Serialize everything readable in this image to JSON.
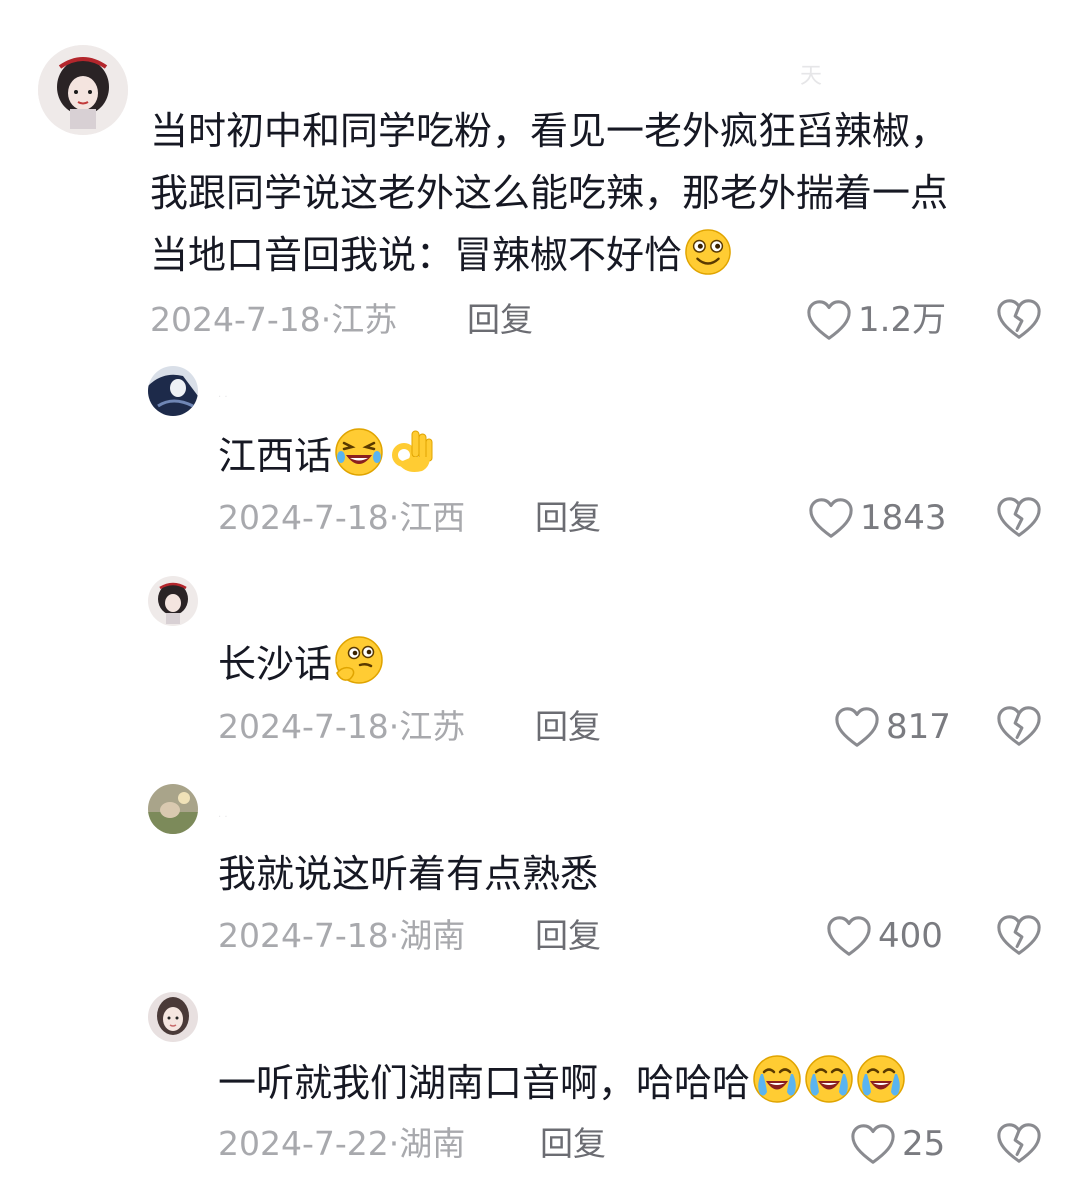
{
  "comments": [
    {
      "text": "当时初中和同学吃粉，看见一老外疯狂舀辣椒，\n我跟同学说这老外这么能吃辣，那老外揣着一点\n当地口音回我说：冒辣椒不好恰",
      "date": "2024-7-18",
      "location": "江苏",
      "reply_label": "回复",
      "likes": "1.2万",
      "emojis": [
        "smirk-face-emoji"
      ]
    },
    {
      "text": "江西话",
      "date": "2024-7-18",
      "location": "江西",
      "reply_label": "回复",
      "likes": "1843",
      "emojis": [
        "rofl-face-emoji",
        "ok-hand-emoji"
      ]
    },
    {
      "text": "长沙话",
      "date": "2024-7-18",
      "location": "江苏",
      "reply_label": "回复",
      "likes": "817",
      "emojis": [
        "thinking-face-emoji"
      ]
    },
    {
      "text": "我就说这听着有点熟悉",
      "date": "2024-7-18",
      "location": "湖南",
      "reply_label": "回复",
      "likes": "400",
      "emojis": []
    },
    {
      "text": "一听就我们湖南口音啊，哈哈哈",
      "date": "2024-7-22",
      "location": "湖南",
      "reply_label": "回复",
      "likes": "25",
      "emojis": [
        "tears-of-joy-emoji",
        "tears-of-joy-emoji",
        "tears-of-joy-emoji"
      ]
    }
  ],
  "date_separator": "·",
  "colors": {
    "text": "#161823",
    "meta": "#a8a9ad",
    "reply": "#6b6c72",
    "icon": "#8a8b90",
    "emoji_yellow": "#ffcc33"
  }
}
